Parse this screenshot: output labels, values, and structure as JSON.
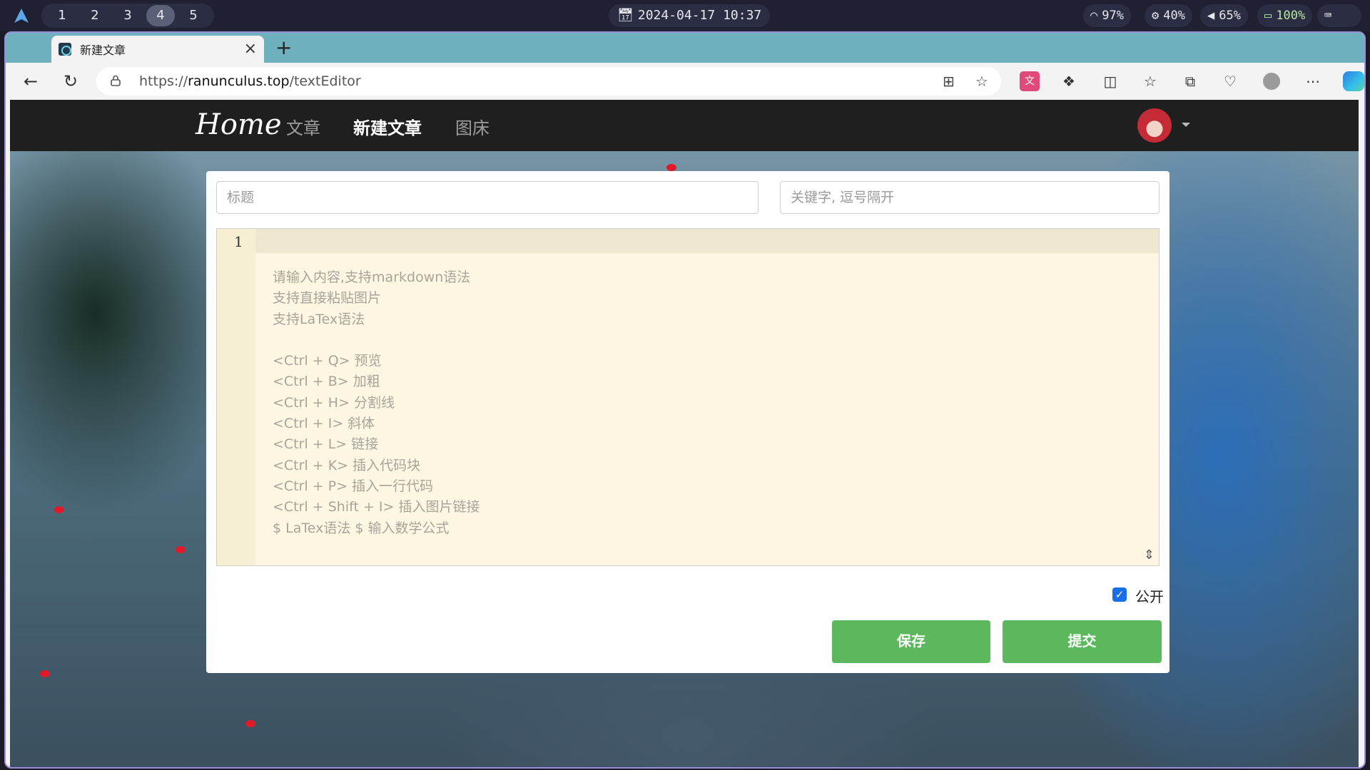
{
  "system": {
    "workspaces": [
      "1",
      "2",
      "3",
      "4",
      "5"
    ],
    "active_workspace": "4",
    "datetime": "2024-04-17 10:37",
    "wifi": "97%",
    "brightness": "40%",
    "volume": "65%",
    "battery": "100%"
  },
  "browser": {
    "tab_title": "新建文章",
    "url_prefix": "https://",
    "url_host": "ranunculus.top",
    "url_path": "/textEditor"
  },
  "site": {
    "brand": "Home",
    "nav": [
      "文章",
      "新建文章",
      "图床"
    ],
    "active_nav": "新建文章"
  },
  "form": {
    "title_placeholder": "标题",
    "keywords_placeholder": "关键字, 逗号隔开",
    "editor_line_number": "1",
    "editor_placeholder": "请输入内容,支持markdown语法\n支持直接粘贴图片\n支持LaTex语法\n\n<Ctrl + Q> 预览\n<Ctrl + B> 加粗\n<Ctrl + H> 分割线\n<Ctrl + I> 斜体\n<Ctrl + L> 链接\n<Ctrl + K> 插入代码块\n<Ctrl + P> 插入一行代码\n<Ctrl + Shift + I> 插入图片链接\n$ LaTex语法 $ 输入数学公式",
    "public_label": "公开",
    "public_checked": true,
    "save_label": "保存",
    "submit_label": "提交"
  },
  "colors": {
    "button_green": "#5cb85c",
    "navbar_bg": "#1f1f1f",
    "editor_bg": "#fdf6e3",
    "checkbox_blue": "#1a6fe8"
  }
}
